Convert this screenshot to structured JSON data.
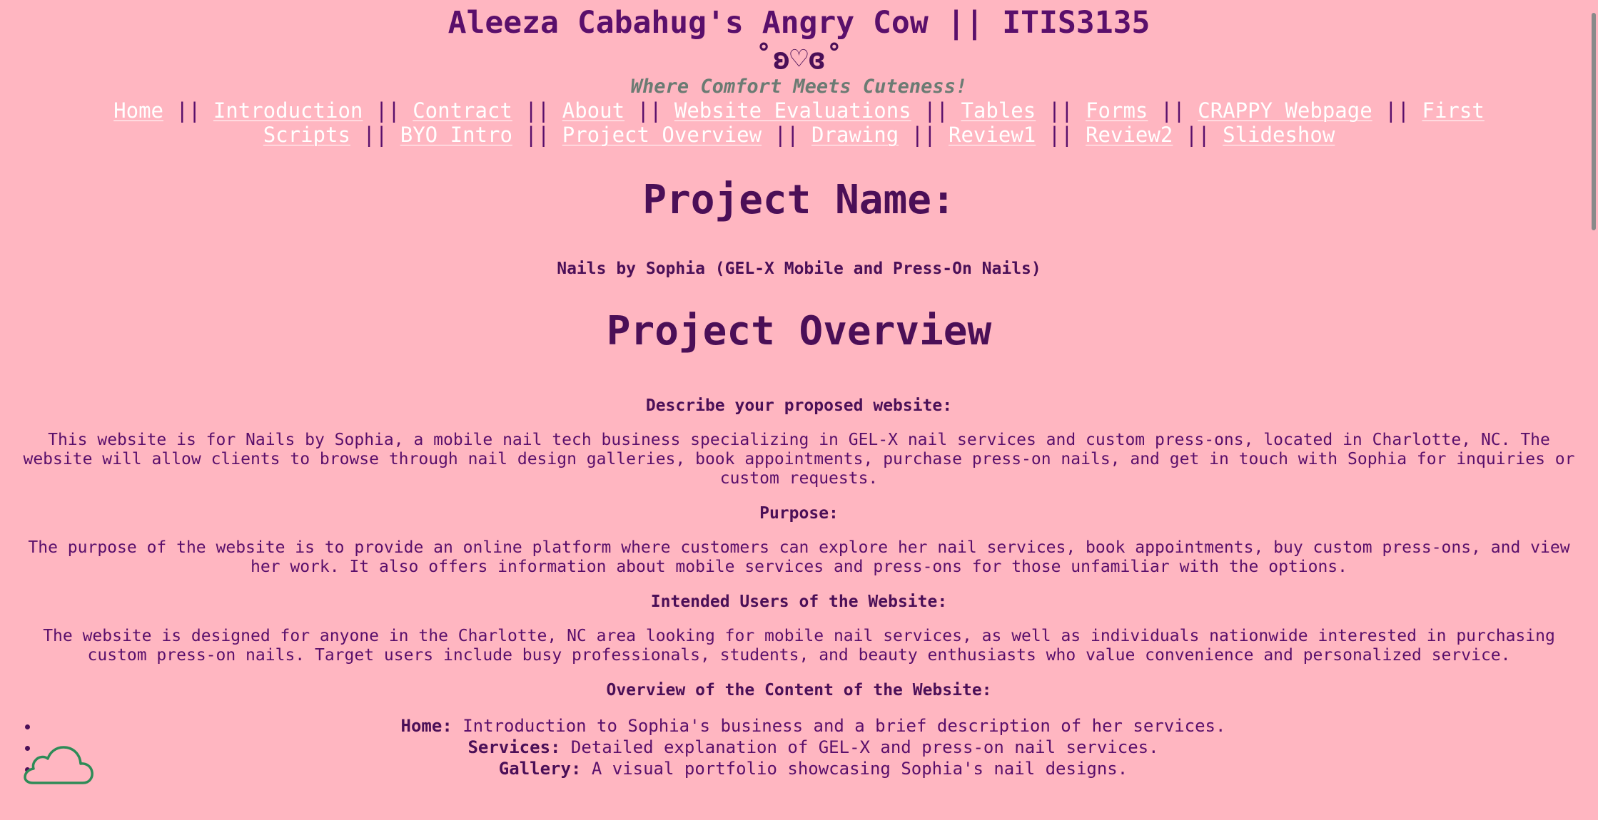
{
  "header": {
    "title": "Aleeza Cabahug's Angry Cow || ITIS3135",
    "emoticon": "˚ʚ♡ɞ˚",
    "tagline": "Where Comfort Meets Cuteness!"
  },
  "nav": {
    "separator": " || ",
    "links": [
      "Home",
      "Introduction",
      "Contract",
      "About",
      "Website Evaluations",
      "Tables",
      "Forms",
      "CRAPPY Webpage",
      "First Scripts",
      "BYO Intro",
      "Project Overview",
      "Drawing",
      "Review1",
      "Review2",
      "Slideshow"
    ]
  },
  "main": {
    "project_name_heading": "Project Name:",
    "project_name_value": "Nails by Sophia (GEL-X Mobile and Press-On Nails)",
    "overview_heading": "Project Overview",
    "sections": [
      {
        "heading": "Describe your proposed website:",
        "text": "This website is for Nails by Sophia, a mobile nail tech business specializing in GEL-X nail services and custom press-ons, located in Charlotte, NC. The website will allow clients to browse through nail design galleries, book appointments, purchase press-on nails, and get in touch with Sophia for inquiries or custom requests."
      },
      {
        "heading": "Purpose:",
        "text": "The purpose of the website is to provide an online platform where customers can explore her nail services, book appointments, buy custom press-ons, and view her work. It also offers information about mobile services and press-ons for those unfamiliar with the options."
      },
      {
        "heading": "Intended Users of the Website:",
        "text": "The website is designed for anyone in the Charlotte, NC area looking for mobile nail services, as well as individuals nationwide interested in purchasing custom press-on nails. Target users include busy professionals, students, and beauty enthusiasts who value convenience and personalized service."
      }
    ],
    "content_heading": "Overview of the Content of the Website:",
    "content_items": [
      {
        "label": "Home:",
        "text": " Introduction to Sophia's business and a brief description of her services."
      },
      {
        "label": "Services:",
        "text": " Detailed explanation of GEL-X and press-on nail services."
      },
      {
        "label": "Gallery:",
        "text": " A visual portfolio showcasing Sophia's nail designs."
      }
    ]
  },
  "colors": {
    "background": "#ffb6c1",
    "heading": "#4b0f57",
    "link": "#ffffff",
    "tagline": "#6b7b73",
    "cloud_stroke": "#2e8b57"
  },
  "icons": {
    "floating": "cloud-icon"
  }
}
